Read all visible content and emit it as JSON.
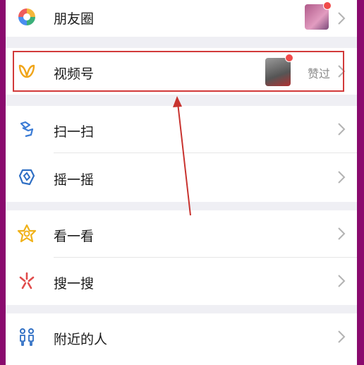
{
  "menu": {
    "moments": {
      "label": "朋友圈",
      "icon": "moments-icon"
    },
    "channels": {
      "label": "视频号",
      "status": "赞过",
      "icon": "channels-icon"
    },
    "scan": {
      "label": "扫一扫",
      "icon": "scan-icon"
    },
    "shake": {
      "label": "摇一摇",
      "icon": "shake-icon"
    },
    "top_stories": {
      "label": "看一看",
      "icon": "top-stories-icon"
    },
    "search": {
      "label": "搜一搜",
      "icon": "search-icon"
    },
    "nearby": {
      "label": "附近的人",
      "icon": "nearby-people-icon"
    }
  },
  "colors": {
    "frame": "#8a0a6e",
    "highlight": "#d23a3a",
    "arrow": "#c8332f",
    "badge": "#f04a4a"
  }
}
